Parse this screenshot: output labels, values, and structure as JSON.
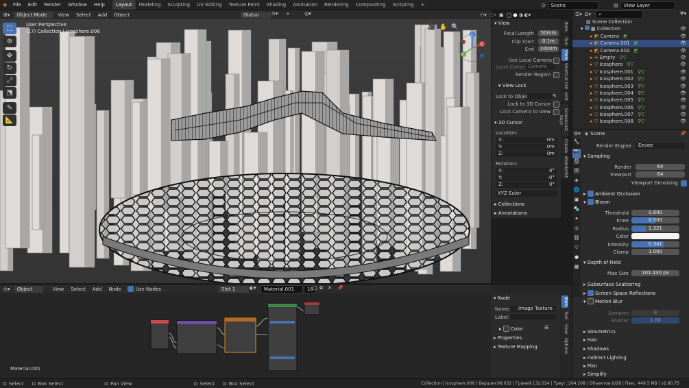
{
  "topbar": {
    "menus": [
      "File",
      "Edit",
      "Render",
      "Window",
      "Help"
    ],
    "workspaces": [
      "Layout",
      "Modeling",
      "Sculpting",
      "UV Editing",
      "Texture Paint",
      "Shading",
      "Animation",
      "Rendering",
      "Compositing",
      "Scripting"
    ],
    "active_workspace": "Layout",
    "add_tab": "+",
    "scene_label": "Scene",
    "view_layer_label": "View Layer"
  },
  "viewport": {
    "mode": "Object Mode",
    "menus": [
      "View",
      "Select",
      "Add",
      "Object"
    ],
    "orientation": "Global",
    "overlay_title": "User Perspective",
    "overlay_subtitle": "(17) Collection | Icosphere.006",
    "gizmo_axes": {
      "x": "X",
      "y": "Y",
      "z": "Z"
    },
    "colors": {
      "bg": "#3a3a3a",
      "building": "#d9d6d3",
      "wire": "#111111"
    }
  },
  "npanel": {
    "tabs": [
      "Item",
      "Tool",
      "View",
      "Shortcut VUr",
      "Edit",
      "Screencast Keys",
      "Create",
      "BlenderKit"
    ],
    "view": {
      "title": "View",
      "focal_label": "Focal Length",
      "focal_value": "50mm",
      "clip_start_label": "Clip Start",
      "clip_start_value": "0.1m",
      "end_label": "End",
      "end_value": "1000m",
      "use_local_camera": "Use Local Camera",
      "local_camera_label": "Local Camera",
      "local_camera_value": "Camera",
      "render_region": "Render Region"
    },
    "viewlock": {
      "title": "View Lock",
      "lock_to_object": "Lock to Object",
      "lock_3d_cursor": "Lock to 3D Cursor",
      "lock_camera": "Lock Camera to View"
    },
    "cursor": {
      "title": "3D Cursor",
      "location_label": "Location:",
      "x_label": "X:",
      "x_value": "0m",
      "y_label": "Y:",
      "y_value": "0m",
      "z_label": "Z:",
      "z_value": "0m",
      "rotation_label": "Rotation:",
      "rx_label": "X:",
      "rx_value": "0°",
      "ry_label": "Y:",
      "ry_value": "-0°",
      "rz_label": "Z:",
      "rz_value": "0°",
      "euler_value": "XYZ Euler"
    },
    "collections_title": "Collections",
    "annotations_title": "Annotations"
  },
  "outliner": {
    "search_placeholder": "",
    "scene_collection": "Scene Collection",
    "collection": "Collection",
    "items": [
      {
        "name": "Camera",
        "selected": false
      },
      {
        "name": "Camera.001",
        "selected": true
      },
      {
        "name": "Camera.002",
        "selected": false
      },
      {
        "name": "Empty",
        "selected": false
      },
      {
        "name": "Icosphere",
        "selected": false
      },
      {
        "name": "Icosphere.001",
        "selected": false
      },
      {
        "name": "Icosphere.002",
        "selected": false
      },
      {
        "name": "Icosphere.003",
        "selected": false
      },
      {
        "name": "Icosphere.004",
        "selected": false
      },
      {
        "name": "Icosphere.005",
        "selected": false
      },
      {
        "name": "Icosphere.006",
        "selected": false
      },
      {
        "name": "Icosphere.007",
        "selected": false
      },
      {
        "name": "Icosphere.008",
        "selected": false
      }
    ]
  },
  "properties": {
    "context": "Scene",
    "render_engine_label": "Render Engine",
    "render_engine_value": "Eevee",
    "sampling_title": "Sampling",
    "render_label": "Render",
    "render_value": "64",
    "viewport_label": "Viewport",
    "viewport_value": "64",
    "viewport_denoising": "Viewport Denoising",
    "ambient_occlusion": "Ambient Occlusion",
    "bloom": "Bloom",
    "threshold_label": "Threshold",
    "threshold_value": "0.800",
    "knee_label": "Knee",
    "knee_value": "0.500",
    "radius_label": "Radius",
    "radius_value": "2.321",
    "color_label": "Color",
    "intensity_label": "Intensity",
    "intensity_value": "0.341",
    "clamp_label": "Clamp",
    "clamp_value": "1.000",
    "dof_title": "Depth of Field",
    "max_size_label": "Max Size",
    "max_size_value": "101.430 px",
    "sss_title": "Subsurface Scattering",
    "ssr": "Screen Space Reflections",
    "motion_blur": "Motion Blur",
    "samples_label": "Samples",
    "samples_value": "8",
    "shutter_label": "Shutter",
    "shutter_value": "1.00",
    "sections": [
      "Volumetrics",
      "Hair",
      "Shadows",
      "Indirect Lighting",
      "Film",
      "Simplify"
    ]
  },
  "node_editor": {
    "editor_type": "Object",
    "menus": [
      "View",
      "Select",
      "Add",
      "Node"
    ],
    "use_nodes": "Use Nodes",
    "slot": "Slot 1",
    "material": "Material.001",
    "users": "16",
    "material_label": "Material.001",
    "sidebar_tabs": [
      "Item",
      "Tool",
      "View",
      "Options"
    ],
    "node_panel": {
      "title": "Node",
      "name_label": "Name:",
      "name_value": "Image Texture",
      "label_label": "Label:",
      "label_value": "",
      "color_label": "Color",
      "properties_title": "Properties",
      "texture_mapping_title": "Texture Mapping"
    }
  },
  "statusbar": {
    "items": [
      "Select",
      "Box Select",
      "Pan View",
      "Select",
      "Box Select"
    ],
    "stats": "Collection | Icosphere.006 | Вершин:99,632 | Граней:132,024 | Треуг.:264,208 | Объектов:0/28 | Пам.: 449.5 MB | v2.80.75"
  }
}
